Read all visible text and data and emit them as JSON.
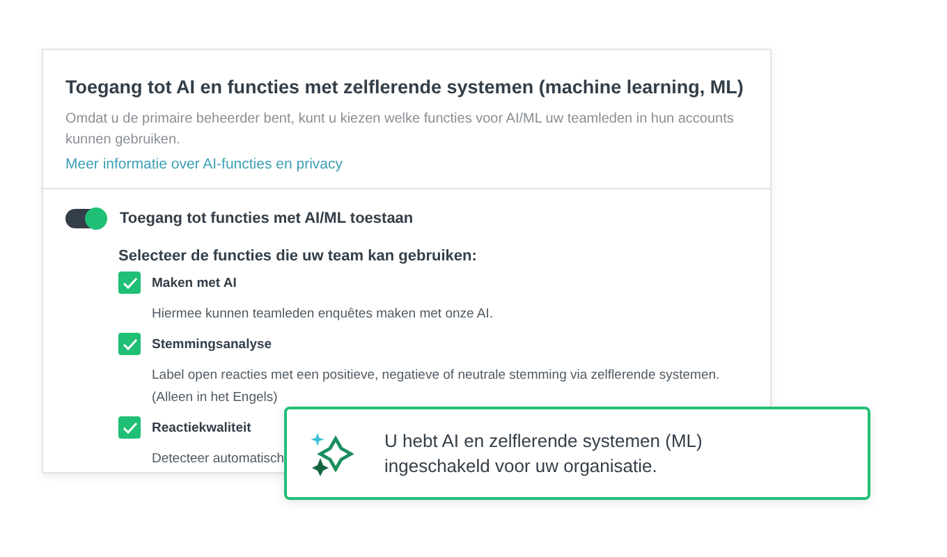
{
  "card": {
    "title": "Toegang tot AI en functies met zelflerende systemen (machine learning, ML)",
    "description": "Omdat u de primaire beheerder bent, kunt u kiezen welke functies voor AI/ML uw teamleden in hun accounts kunnen gebruiken.",
    "link": "Meer informatie over AI-functies en privacy"
  },
  "toggle": {
    "label": "Toegang tot functies met AI/ML toestaan",
    "on": true
  },
  "features_heading": "Selecteer de functies die uw team kan gebruiken:",
  "features": [
    {
      "label": "Maken met AI",
      "checked": true,
      "description": "Hiermee kunnen teamleden enquêtes maken met onze AI."
    },
    {
      "label": "Stemmingsanalyse",
      "checked": true,
      "description": "Label open reacties met een positieve, negatieve of neutrale stemming via zelflerende systemen.",
      "note": "(Alleen in het Engels)"
    },
    {
      "label": "Reactiekwaliteit",
      "checked": true,
      "description": "Detecteer automatisch"
    }
  ],
  "toast": {
    "message": "U hebt AI en zelflerende systemen (ML) ingeschakeld voor uw organisatie."
  }
}
